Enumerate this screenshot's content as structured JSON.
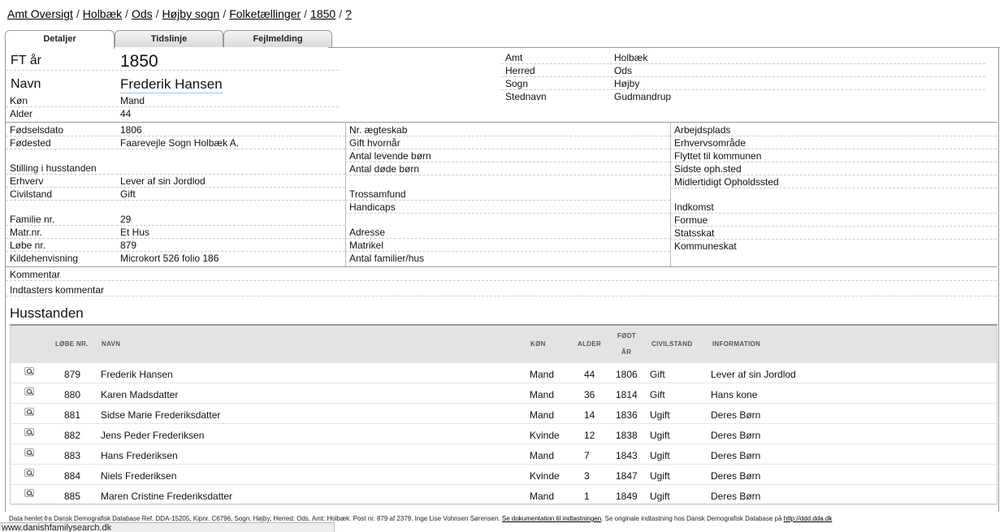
{
  "breadcrumb": {
    "items": [
      "Amt Oversigt",
      "Holbæk",
      "Ods",
      "Højby sogn",
      "Folketællinger",
      "1850",
      "?"
    ],
    "separator": "/"
  },
  "tabs": [
    "Detaljer",
    "Tidslinje",
    "Fejlmelding"
  ],
  "header": {
    "ft_label": "FT år",
    "ft_value": "1850",
    "navn_label": "Navn",
    "navn_value": "Frederik Hansen",
    "kon_label": "Køn",
    "kon_value": "Mand",
    "alder_label": "Alder",
    "alder_value": "44"
  },
  "place": {
    "amt_label": "Amt",
    "amt_value": "Holbæk",
    "herred_label": "Herred",
    "herred_value": "Ods",
    "sogn_label": "Sogn",
    "sogn_value": "Højby",
    "stednavn_label": "Stednavn",
    "stednavn_value": "Gudmandrup"
  },
  "left": {
    "fodselsdato_label": "Fødselsdato",
    "fodselsdato_value": "1806",
    "fodested_label": "Fødested",
    "fodested_value": "Faarevejle Sogn Holbæk A.",
    "stilling_label": "Stilling i husstanden",
    "erhverv_label": "Erhverv",
    "erhverv_value": "Lever af sin Jordlod",
    "civilstand_label": "Civilstand",
    "civilstand_value": "Gift",
    "familie_label": "Familie nr.",
    "familie_value": "29",
    "matr_label": "Matr.nr.",
    "matr_value": "Et Hus",
    "lobe_label": "Løbe nr.",
    "lobe_value": "879",
    "kilde_label": "Kildehenvisning",
    "kilde_value": "Microkort 526 folio 186"
  },
  "middle": {
    "aegteskab": "Nr. ægteskab",
    "gift_hvornaar": "Gift hvornår",
    "levende_born": "Antal levende børn",
    "dode_born": "Antal døde børn",
    "trossamfund": "Trossamfund",
    "handicaps": "Handicaps",
    "adresse": "Adresse",
    "matrikel": "Matrikel",
    "familier_hus": "Antal familier/hus"
  },
  "right": {
    "arbejdsplads": "Arbejdsplads",
    "erhvervsomraade": "Erhvervsområde",
    "flyttet": "Flyttet til kommunen",
    "sidste_oph": "Sidste oph.sted",
    "midlertidigt": "Midlertidigt Opholdssted",
    "indkomst": "Indkomst",
    "formue": "Formue",
    "statsskat": "Statsskat",
    "kommuneskat": "Kommuneskat"
  },
  "comments": {
    "kommentar": "Kommentar",
    "indtaster": "Indtasters kommentar"
  },
  "household": {
    "title": "Husstanden",
    "headers": {
      "lobe": "LØBE NR.",
      "navn": "NAVN",
      "kon": "KØN",
      "alder": "ALDER",
      "fodt1": "FØDT",
      "fodt2": "ÅR",
      "civilstand": "CIVILSTAND",
      "information": "INFORMATION"
    },
    "rows": [
      {
        "lobe": "879",
        "navn": "Frederik Hansen",
        "kon": "Mand",
        "alder": "44",
        "fodt": "1806",
        "civil": "Gift",
        "info": "Lever af sin Jordlod"
      },
      {
        "lobe": "880",
        "navn": "Karen Madsdatter",
        "kon": "Mand",
        "alder": "36",
        "fodt": "1814",
        "civil": "Gift",
        "info": "Hans kone"
      },
      {
        "lobe": "881",
        "navn": "Sidse Marie Frederiksdatter",
        "kon": "Mand",
        "alder": "14",
        "fodt": "1836",
        "civil": "Ugift",
        "info": "Deres Børn"
      },
      {
        "lobe": "882",
        "navn": "Jens Peder Frederiksen",
        "kon": "Kvinde",
        "alder": "12",
        "fodt": "1838",
        "civil": "Ugift",
        "info": "Deres Børn"
      },
      {
        "lobe": "883",
        "navn": "Hans Frederiksen",
        "kon": "Mand",
        "alder": "7",
        "fodt": "1843",
        "civil": "Ugift",
        "info": "Deres Børn"
      },
      {
        "lobe": "884",
        "navn": "Niels Frederiksen",
        "kon": "Kvinde",
        "alder": "3",
        "fodt": "1847",
        "civil": "Ugift",
        "info": "Deres Børn"
      },
      {
        "lobe": "885",
        "navn": "Maren Cristine Frederiksdatter",
        "kon": "Mand",
        "alder": "1",
        "fodt": "1849",
        "civil": "Ugift",
        "info": "Deres Børn"
      }
    ]
  },
  "footer": {
    "text": "Data hentet fra Dansk Demografisk Database Ref. DDA-15205, Kipnr. C6796, Sogn: Højby, Herred: Ods, Amt: Holbæk. Post nr. 879 af 2379. Inge Lise Vohnsen Sørensen.",
    "link1": "Se dokumentation til indtastningen",
    "mid": ". Se originale indtastning hos Dansk Demografisk Database på",
    "link2": "http://ddd.dda.dk"
  },
  "status_bar": "www.danishfamilysearch.dk",
  "icons": {
    "detail": "magnifier-icon"
  }
}
